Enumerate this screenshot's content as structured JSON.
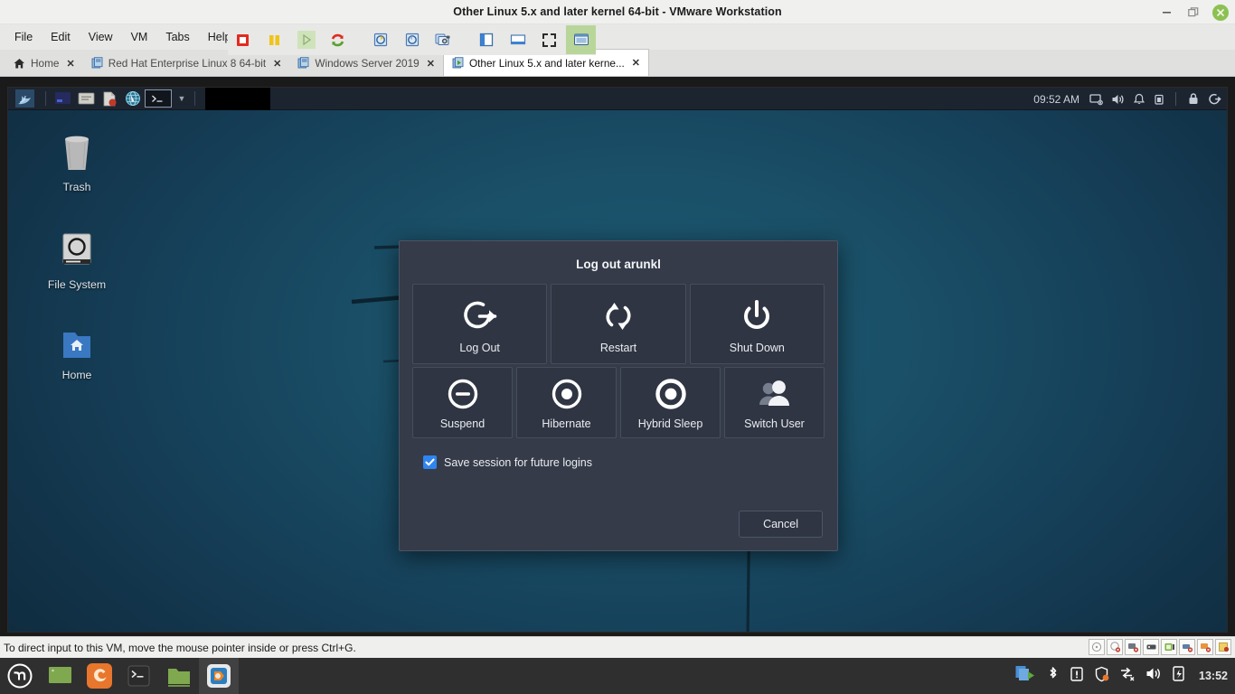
{
  "window": {
    "title": "Other Linux 5.x and later kernel 64-bit - VMware Workstation",
    "minimize_label": "Minimize",
    "restore_label": "Restore",
    "close_label": "Close"
  },
  "menubar": {
    "items": [
      {
        "label": "File"
      },
      {
        "label": "Edit"
      },
      {
        "label": "View"
      },
      {
        "label": "VM"
      },
      {
        "label": "Tabs"
      },
      {
        "label": "Help"
      }
    ]
  },
  "toolbar": {
    "buttons": [
      {
        "name": "power-off-icon",
        "tooltip": "Power Off"
      },
      {
        "name": "suspend-icon",
        "tooltip": "Suspend"
      },
      {
        "name": "play-icon",
        "tooltip": "Power On",
        "disabled": true
      },
      {
        "name": "restart-icon",
        "tooltip": "Restart Guest"
      },
      {
        "name": "snapshot-take-icon",
        "tooltip": "Take Snapshot"
      },
      {
        "name": "snapshot-revert-icon",
        "tooltip": "Revert Snapshot"
      },
      {
        "name": "snapshot-manager-icon",
        "tooltip": "Manage Snapshots"
      },
      {
        "name": "sidebar-icon",
        "tooltip": "Show or Hide Library"
      },
      {
        "name": "console-view-icon",
        "tooltip": "Console View"
      },
      {
        "name": "fullscreen-icon",
        "tooltip": "Enter Full Screen"
      },
      {
        "name": "unity-icon",
        "tooltip": "Unity Mode",
        "active": true
      }
    ]
  },
  "tabs": [
    {
      "label": "Home",
      "icon": "home-icon",
      "selected": false
    },
    {
      "label": "Red Hat Enterprise Linux 8 64-bit",
      "icon": "vm-icon",
      "selected": false
    },
    {
      "label": "Windows Server 2019",
      "icon": "vm-icon",
      "selected": false
    },
    {
      "label": "Other Linux 5.x and later kerne...",
      "icon": "vm-icon-running",
      "selected": true
    }
  ],
  "guest": {
    "panel": {
      "whisker_menu": "whisker-menu-icon",
      "launchers": [
        {
          "name": "show-desktop-icon"
        },
        {
          "name": "file-manager-icon"
        },
        {
          "name": "text-editor-icon"
        },
        {
          "name": "web-browser-icon"
        },
        {
          "name": "terminal-icon"
        }
      ],
      "chevron": "chevron-down-icon",
      "clock": "09:52 AM",
      "tray": [
        {
          "name": "display-icon"
        },
        {
          "name": "volume-icon"
        },
        {
          "name": "notification-bell-icon"
        },
        {
          "name": "battery-icon"
        },
        {
          "name": "lock-screen-icon"
        },
        {
          "name": "log-out-icon"
        }
      ]
    },
    "desktop_icons": [
      {
        "label": "Trash",
        "icon": "trash-icon"
      },
      {
        "label": "File System",
        "icon": "file-system-icon"
      },
      {
        "label": "Home",
        "icon": "home-folder-icon"
      }
    ],
    "dialog": {
      "title": "Log out arunkl",
      "actions_row1": [
        {
          "label": "Log Out",
          "icon": "log-out-icon"
        },
        {
          "label": "Restart",
          "icon": "restart-icon"
        },
        {
          "label": "Shut Down",
          "icon": "power-icon"
        }
      ],
      "actions_row2": [
        {
          "label": "Suspend",
          "icon": "suspend-icon"
        },
        {
          "label": "Hibernate",
          "icon": "hibernate-icon"
        },
        {
          "label": "Hybrid Sleep",
          "icon": "hybrid-sleep-icon"
        },
        {
          "label": "Switch User",
          "icon": "switch-user-icon"
        }
      ],
      "checkbox": {
        "label": "Save session for future logins",
        "checked": true
      },
      "cancel_label": "Cancel"
    }
  },
  "statusbar": {
    "message": "To direct input to this VM, move the mouse pointer inside or press Ctrl+G.",
    "devices": [
      {
        "name": "hard-disk-icon"
      },
      {
        "name": "cd-drive-icon"
      },
      {
        "name": "network-adapter-icon"
      },
      {
        "name": "usb-controller-icon"
      },
      {
        "name": "sound-card-icon"
      },
      {
        "name": "printer-icon"
      },
      {
        "name": "display-adapter-icon"
      },
      {
        "name": "message-log-icon"
      }
    ]
  },
  "taskbar": {
    "menu_icon": "linux-mint-menu-icon",
    "launchers": [
      {
        "name": "show-desktop-icon"
      },
      {
        "name": "firefox-icon"
      },
      {
        "name": "terminal-icon"
      },
      {
        "name": "files-icon"
      },
      {
        "name": "vmware-workstation-icon",
        "running": true
      }
    ],
    "tray": [
      {
        "name": "workspace-switcher-icon"
      },
      {
        "name": "bluetooth-icon"
      },
      {
        "name": "update-manager-icon"
      },
      {
        "name": "firewall-shield-icon"
      },
      {
        "name": "network-disconnected-icon"
      },
      {
        "name": "volume-icon"
      },
      {
        "name": "power-battery-icon"
      }
    ],
    "clock": "13:52"
  },
  "colors": {
    "dialog_bg": "#353b48",
    "dialog_button_bg": "#2f3542",
    "checkbox_accent": "#2f84f0",
    "desktop_teal": "#1a5068",
    "panel_bg": "#1c2430",
    "taskbar_bg": "#2f2f2f",
    "toolbar_active": "#b9d69a",
    "close_button": "#8cc152"
  }
}
